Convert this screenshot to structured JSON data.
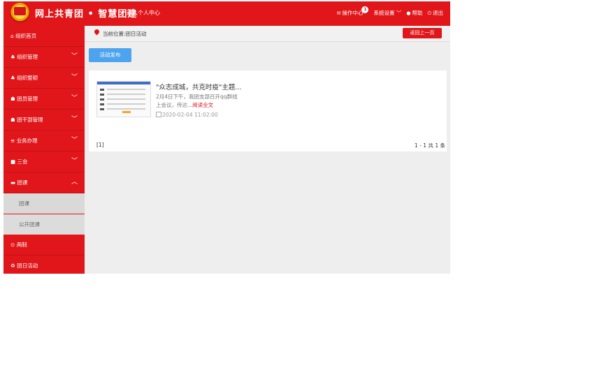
{
  "header": {
    "brand": "网上共青团 • 智慧团建",
    "personal_center": "进入个人中心",
    "nav": {
      "op_center": "操作中心",
      "op_center_badge": "1",
      "settings": "系统设置",
      "help": "帮助",
      "logout": "退出"
    }
  },
  "sidebar": {
    "items": [
      {
        "label": "组织首页"
      },
      {
        "label": "组织管理"
      },
      {
        "label": "组织整顿"
      },
      {
        "label": "团员管理"
      },
      {
        "label": "团干部管理"
      },
      {
        "label": "业务办理"
      },
      {
        "label": "三会"
      },
      {
        "label": "团课"
      },
      {
        "label": "两制"
      },
      {
        "label": "团日活动"
      }
    ],
    "subitems": [
      {
        "label": "团课"
      },
      {
        "label": "公开团课"
      }
    ]
  },
  "breadcrumb": {
    "text": "当前位置:团日活动",
    "back_label": "返回上一页"
  },
  "toolbar": {
    "publish_label": "活动发布"
  },
  "article": {
    "title": "\"众志成城，共克时疫\"主题...",
    "desc": "2月4日下午，我团支部召开qq群线上会议，传达...",
    "read_more": "阅读全文",
    "date": "2020-02-04 11:02:00"
  },
  "pagination": {
    "current": "[1]",
    "summary": "1 - 1  共 1 条"
  },
  "colors": {
    "brand_red": "#e0161a",
    "button_blue": "#4da3ee"
  },
  "icons": [
    "home-icon",
    "org-icon",
    "group-icon",
    "list-icon",
    "edit-icon",
    "folder-icon",
    "circle-icon",
    "recycle-icon",
    "mail-icon",
    "gear-icon",
    "help-icon",
    "power-icon",
    "location-icon",
    "calendar-icon",
    "chevron-down-icon",
    "chevron-up-icon"
  ]
}
